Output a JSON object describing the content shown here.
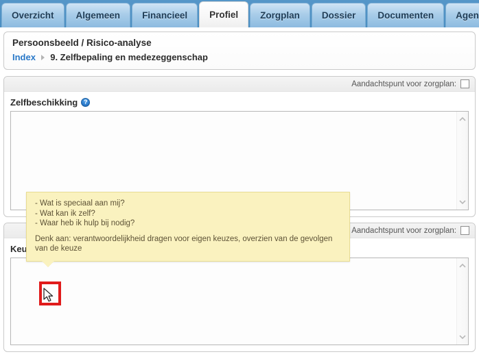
{
  "tabs": [
    {
      "label": "Overzicht",
      "active": false
    },
    {
      "label": "Algemeen",
      "active": false
    },
    {
      "label": "Financieel",
      "active": false
    },
    {
      "label": "Profiel",
      "active": true
    },
    {
      "label": "Zorgplan",
      "active": false
    },
    {
      "label": "Dossier",
      "active": false
    },
    {
      "label": "Documenten",
      "active": false
    },
    {
      "label": "Agenda",
      "active": false
    }
  ],
  "header": {
    "title": "Persoonsbeeld / Risico-analyse",
    "breadcrumb_link": "Index",
    "breadcrumb_current": "9. Zelfbepaling en medezeggenschap",
    "separator_icon": "triangle-right-icon"
  },
  "sections": [
    {
      "attention_label": "Aandachtspunt voor zorgplan:",
      "attention_checked": false,
      "field_label": "Zelfbeschikking",
      "help_icon": "question-mark-icon",
      "textarea_value": "",
      "textarea_placeholder": ""
    },
    {
      "attention_label": "Aandachtspunt voor zorgplan:",
      "attention_checked": false,
      "field_label": "Keuzes",
      "help_icon": "question-mark-icon",
      "textarea_value": "",
      "textarea_placeholder": ""
    }
  ],
  "tooltip": {
    "lines": [
      "- Wat is speciaal aan mij?",
      "- Wat kan ik zelf?",
      "- Waar heb ik hulp bij nodig?"
    ],
    "note": "Denk aan: verantwoordelijkheid dragen voor eigen keuzes, overzien van de gevolgen van de keuze"
  },
  "annotations": {
    "highlight_color": "#e01b1b",
    "cursor_icon": "mouse-pointer-icon"
  },
  "colors": {
    "tabbar_blue": "#4a8ec2",
    "tab_blue": "#a9cde9",
    "link_blue": "#2878c8",
    "tooltip_bg": "#faf2bf",
    "tooltip_border": "#e8dc92",
    "help_blue": "#2f7fd0"
  },
  "scroll": {
    "up_icon": "chevron-up-icon",
    "down_icon": "chevron-down-icon"
  }
}
